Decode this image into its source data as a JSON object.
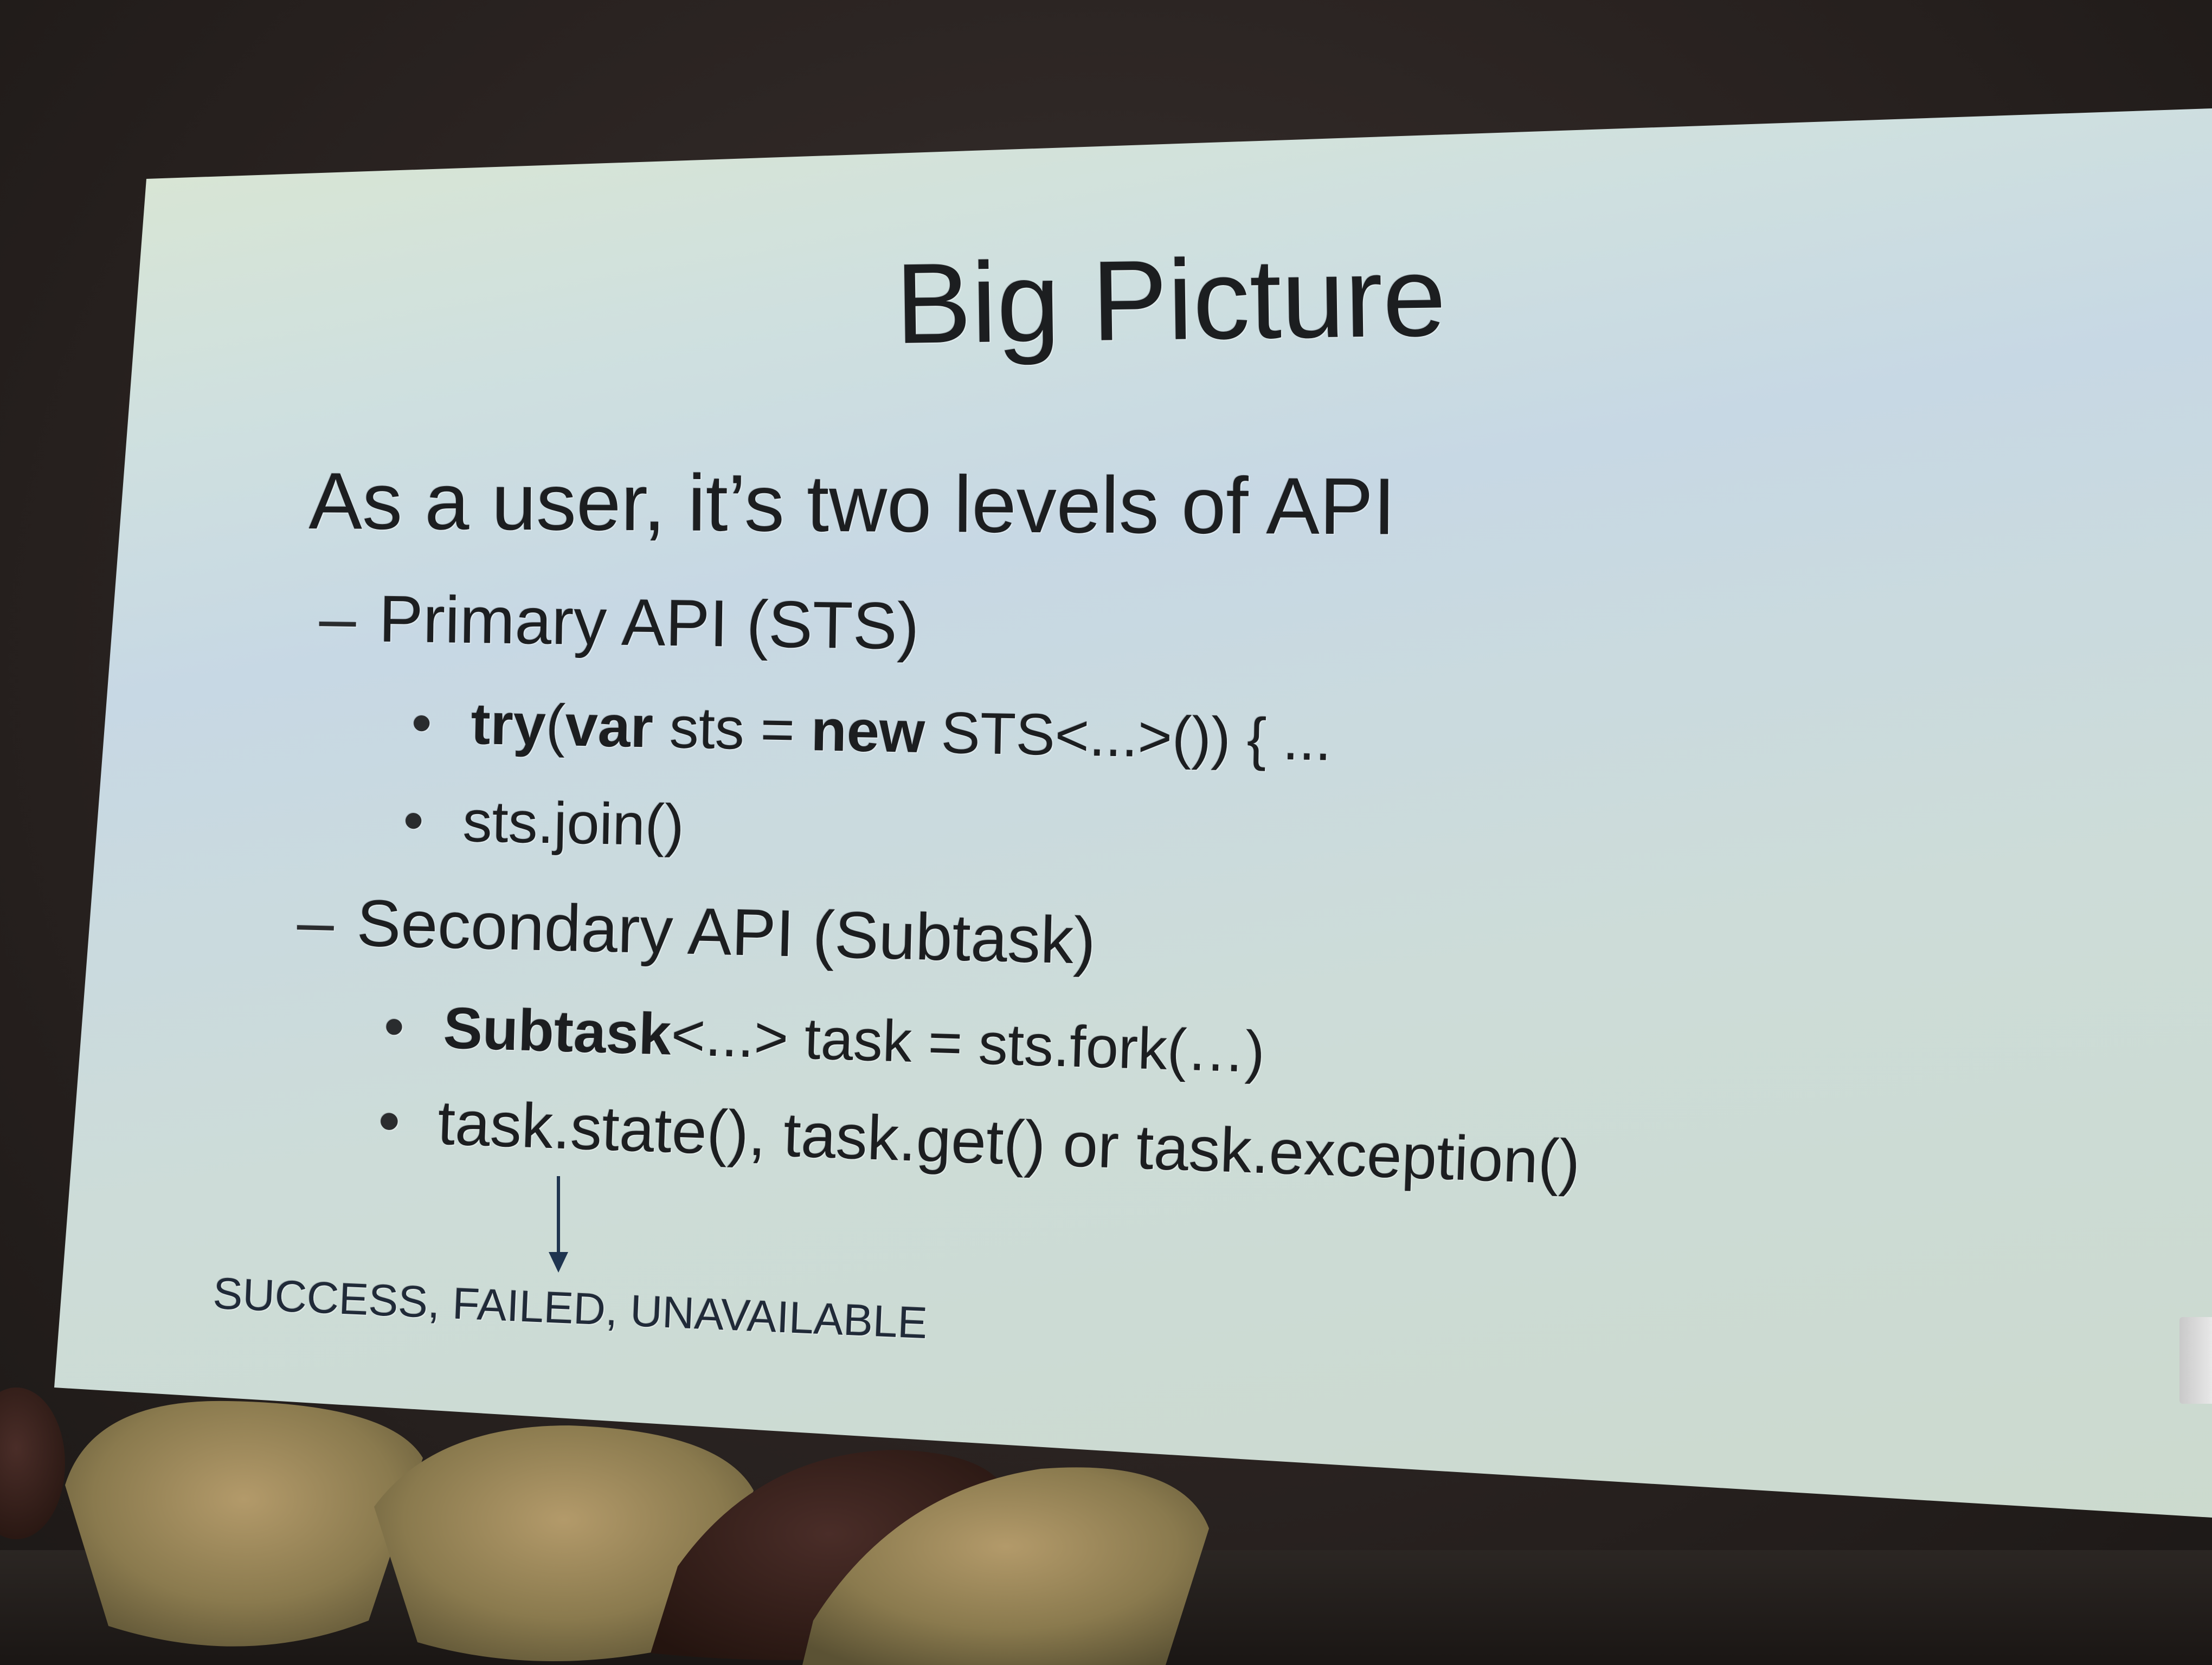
{
  "slide": {
    "title": "Big Picture",
    "subtitle": "As a user, it’s two levels of API",
    "primary": {
      "marker": "–",
      "label": "Primary API",
      "paren": "(STS)",
      "bullets": [
        {
          "marker": "•",
          "kw_try": "try",
          "open_paren": "(",
          "kw_var": "var",
          "mid": " sts = ",
          "kw_new": "new",
          "rest": " STS<...>()) { ..."
        },
        {
          "marker": "•",
          "text": "sts.join()"
        }
      ]
    },
    "secondary": {
      "marker": "–",
      "label": "Secondary API",
      "paren": "(Subtask)",
      "bullets": [
        {
          "marker": "•",
          "kw_subtask": "Subtask",
          "rest": "<...> task = sts.fork(…)"
        },
        {
          "marker": "•",
          "text": "task.state(), task.get() or task.exception()"
        }
      ]
    },
    "state_values": "SUCCESS, FAILED, UNAVAILABLE"
  },
  "icons": {
    "arrow": "down-arrow-icon"
  },
  "colors": {
    "slide_top": "#dfe9cc",
    "slide_mid": "#c7d8e4",
    "slide_bottom": "#cbd9cc",
    "text": "#1c1e20",
    "arrow": "#1f3550",
    "room": "#2a2422"
  }
}
